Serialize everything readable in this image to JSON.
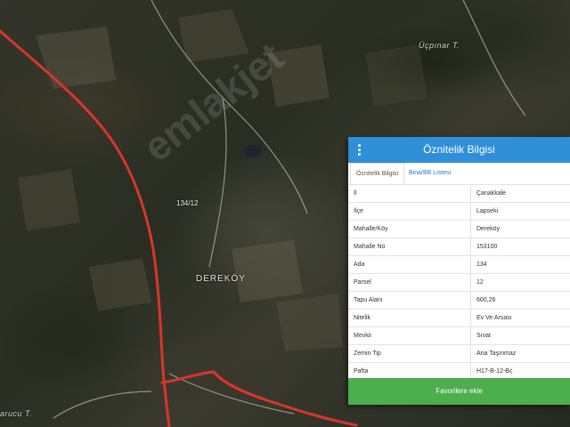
{
  "map": {
    "labels": {
      "ucpinar": "Üçpınar T.",
      "village": "DEREKÖY",
      "block": "134/12",
      "bottom_left": "arucu T."
    },
    "watermark": "emlakjet"
  },
  "panel": {
    "title": "Öznitelik Bilgisi",
    "tabs": [
      "Öznitelik Bilgisi",
      "Bina/BB Listesi"
    ],
    "rows": [
      {
        "key": "İl",
        "value": "Çanakkale"
      },
      {
        "key": "İlçe",
        "value": "Lapseki"
      },
      {
        "key": "Mahalle/Köy",
        "value": "Dereköy"
      },
      {
        "key": "Mahalle No",
        "value": "153100"
      },
      {
        "key": "Ada",
        "value": "134"
      },
      {
        "key": "Parsel",
        "value": "12"
      },
      {
        "key": "Tapu Alanı",
        "value": "600,26"
      },
      {
        "key": "Nitelik",
        "value": "Ev Ve Arsası"
      },
      {
        "key": "Mevkii",
        "value": "Sıvat"
      },
      {
        "key": "Zemin Tip",
        "value": "Ana Taşınmaz"
      },
      {
        "key": "Pafta",
        "value": "H17-B-12-Bc"
      }
    ],
    "favorite_button": "Favorilere ekle"
  },
  "colors": {
    "header": "#2f8fd8",
    "button": "#4cae4c",
    "road": "#d9352a"
  }
}
